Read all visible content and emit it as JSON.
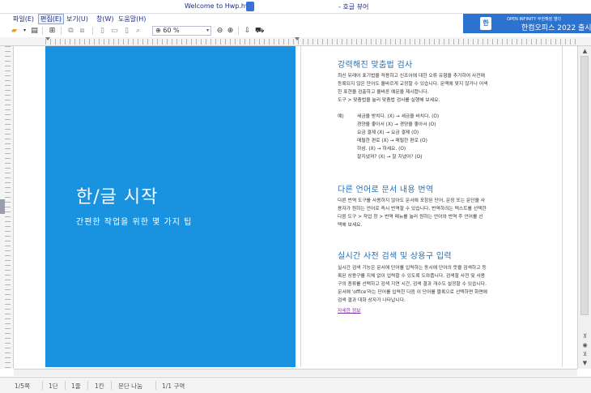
{
  "titlebar": {
    "app_title": "Welcome to Hwp.hwp",
    "doc_title": "- 호글 뷰어"
  },
  "menu": {
    "items": [
      "파일(E)",
      "편집(E)",
      "보기(U)",
      "창(W)",
      "도움말(H)"
    ],
    "active_index": 1
  },
  "ad": {
    "icon_label": "한",
    "small_text": "OPEN INFINITY 무한확장 열다",
    "big_text": "한컴오피스 2022 출시",
    "color": "#2b73cf"
  },
  "toolbar": {
    "zoom_value": "60 %"
  },
  "slide": {
    "title": "한/글 시작",
    "subtitle": "간편한 작업을 위한 몇 가지 팁",
    "background": "#1993e0"
  },
  "page": {
    "section1": {
      "heading": "강력해진 맞춤법 검사",
      "lines": [
        "최신 뒤래어 표기법을 적용하고 신조어에 대한 오류 유형을 추가하여 사전에",
        "등록되지 않은 단어도 올바르게 교정할 수 있습니다. 문맥에 맞지 않거나 어색",
        "한 표현을 검출하고 올바른 예문을 제시합니다.",
        "도구 > 맞춤법을 눌러 맞춤법 검사를 실행해 보세요."
      ],
      "example_label": "예)",
      "examples": [
        "세금을 받치다. (X) → 세금을 바치다. (O)",
        "경양을 좋아서 (X) → 경양을 좋아서 (O)",
        "요금 결제 (X) → 요금 결제 (O)",
        "매될한 편로 (X) → 매될한 편로 (O)",
        "하삼. (X) → 하세요. (O)",
        "잘지냈져? (X) → 잘 지냈어? (O)"
      ]
    },
    "section2": {
      "heading": "다른 언어로 문서 내용 번역",
      "lines": [
        "다른 번역 도구를 사용하지 않아도 문서에 포함된 단어, 문장 또는 문단을 사",
        "용자가 원하는 언어로 즉시 번역할 수 있습니다. 번역하려는 텍스트를 선택한",
        "다음 도구 > 작업 창 > 번역 메뉴를 눌러 원하는 언어와 번역 후 언어를 선",
        "택해 보세요."
      ]
    },
    "section3": {
      "heading": "실시간 사전 검색 및 상용구 입력",
      "lines": [
        "실시간 검색 기능은 문서에 단어를 입력하는 동시에 단어의 뜻을 검색하고 등",
        "록된 상용구를 지체 없이 입력할 수 있도록 도와줍니다. 검색할 사전 및 사용",
        "구의 종류를 선택하고 검색 지연 시간, 검색 결과 개수도 설정할 수 있습니다.",
        "문서에 'office'라는 단어를 입력한 다음 이 단어를 블록으로 선택하면 화면에",
        "검색 결과 대화 상자가 나타납니다."
      ],
      "link": "자세한 정보"
    }
  },
  "status": {
    "items": [
      "1/5쪽",
      "1단",
      "1줄",
      "1칸",
      "문단 나눔",
      "1/1 구역"
    ]
  }
}
